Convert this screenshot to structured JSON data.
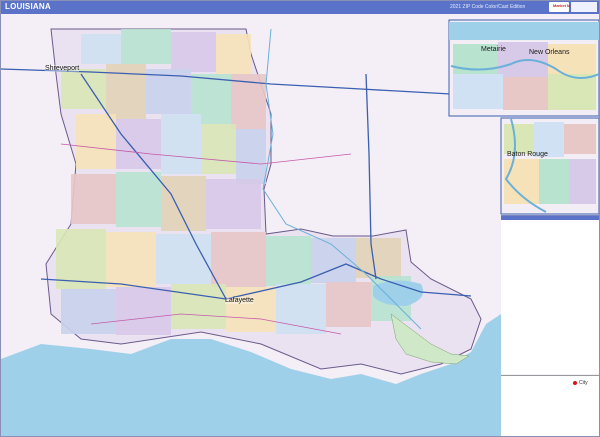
{
  "header": {
    "title": "LOUISIANA",
    "edition": "2021 ZIP Code Color/Cast Edition",
    "publisher_mark": "Market MAPS"
  },
  "insets": {
    "new_orleans_area": {
      "cities": [
        "Metairie",
        "New Orleans"
      ]
    },
    "baton_rouge_area": {
      "cities": [
        "Baton Rouge"
      ]
    }
  },
  "main_map": {
    "cities": [
      "Shreveport",
      "Lafayette"
    ]
  },
  "legend": {
    "city_key": "City"
  },
  "colors": {
    "title_bar": "#5a73c8",
    "water": "#9fd0ea",
    "neighbor_states": "#f3eef6",
    "zip_palette": [
      "#d7c9e8",
      "#b7e3cf",
      "#f6e2b8",
      "#cfe1f2",
      "#e8c7c7",
      "#d9e7b7",
      "#c9d3ec",
      "#e2d3b8"
    ],
    "interstate": "#3a5fb0",
    "highway": "#c45aa8"
  }
}
